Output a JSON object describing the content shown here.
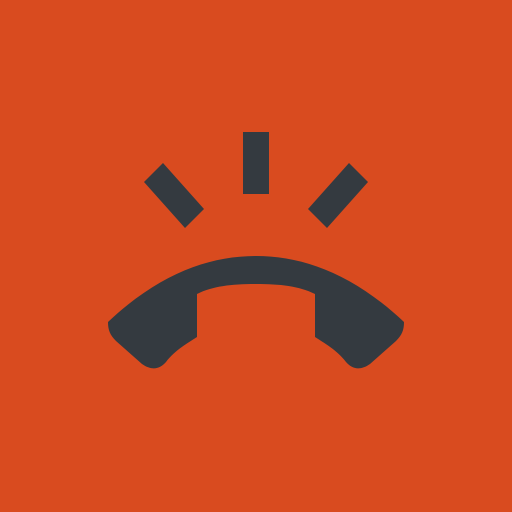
{
  "app": {
    "icon": "missed-call-icon",
    "colors": {
      "background": "#D94B1F",
      "icon": "#343A40"
    }
  }
}
